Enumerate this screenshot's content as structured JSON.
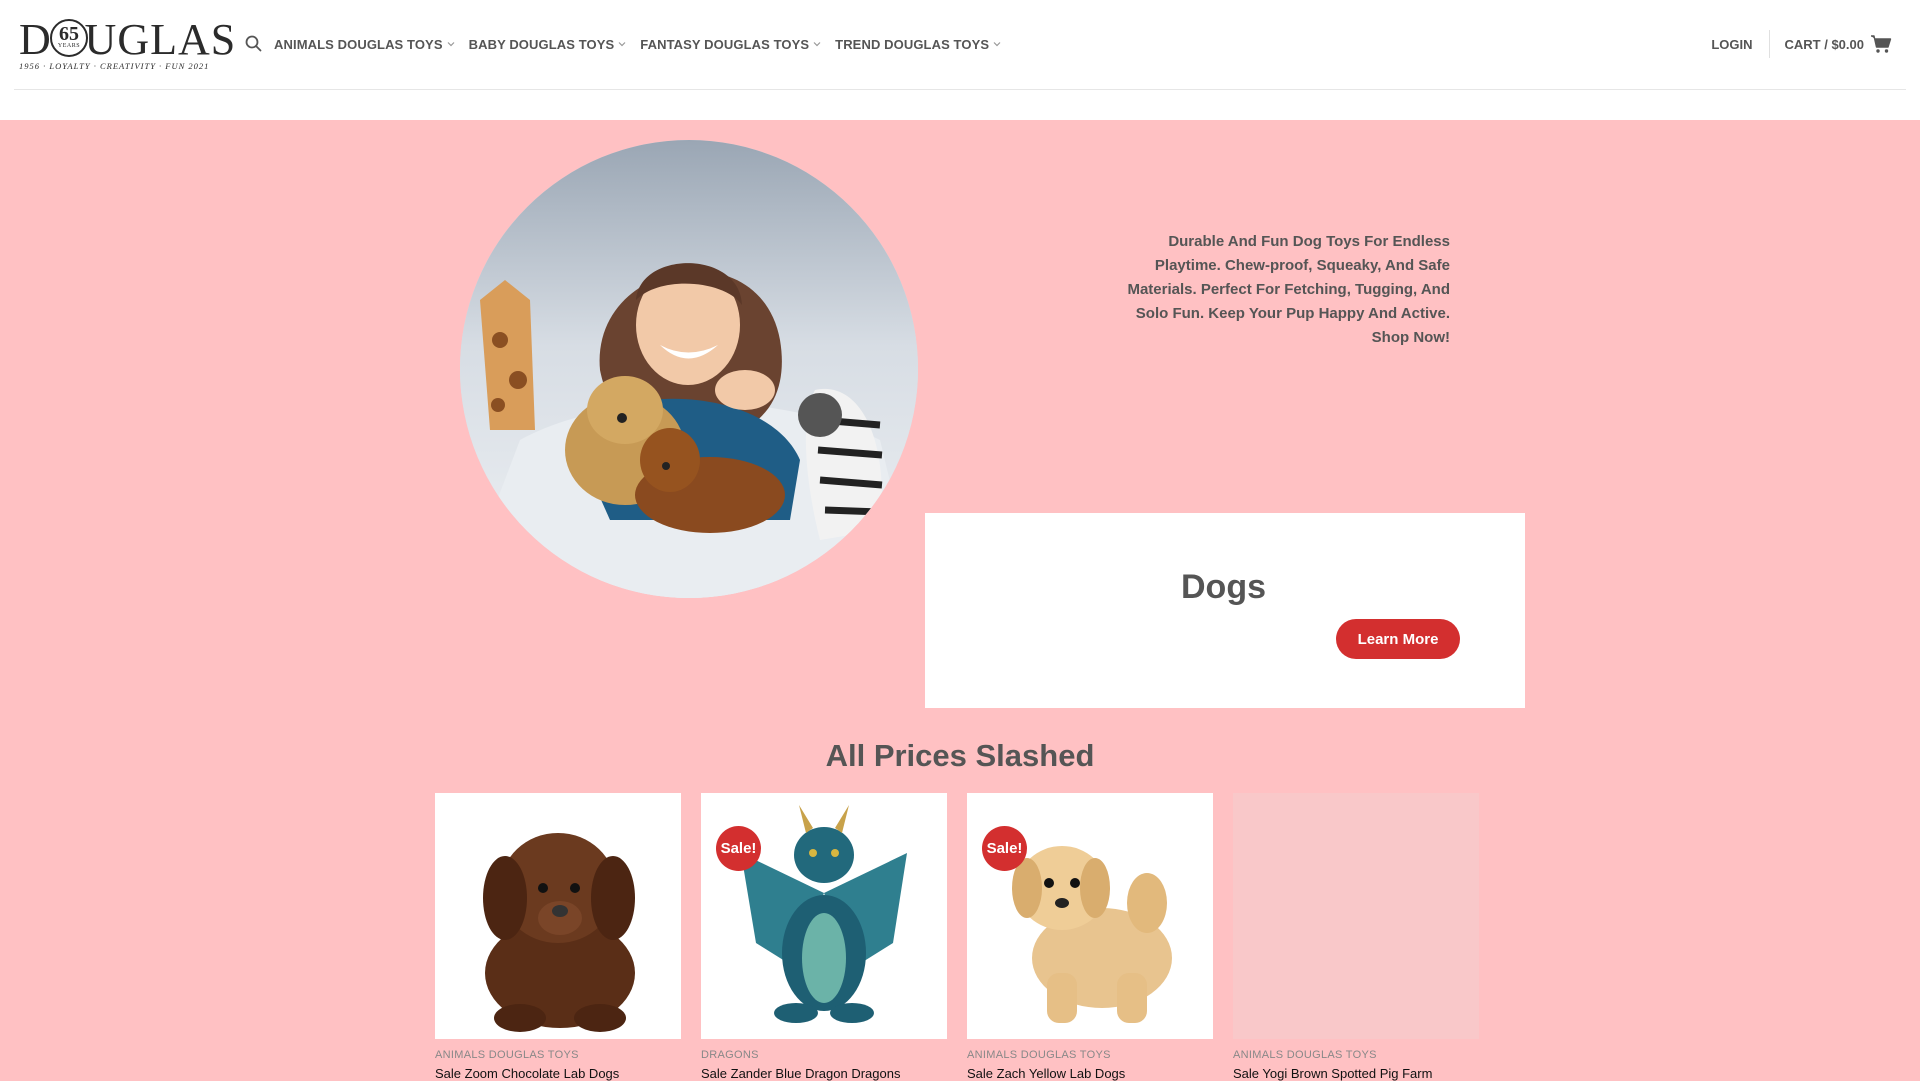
{
  "header": {
    "logo": {
      "word": "DOUGLAS",
      "years": "65",
      "years_label": "YEARS",
      "tagline": "1956 · LOYALTY · CREATIVITY · FUN 2021"
    },
    "search_icon": "search-icon",
    "nav": [
      {
        "label": "ANIMALS DOUGLAS TOYS"
      },
      {
        "label": "BABY DOUGLAS TOYS"
      },
      {
        "label": "FANTASY DOUGLAS TOYS"
      },
      {
        "label": "TREND DOUGLAS TOYS"
      }
    ],
    "login": "LOGIN",
    "cart": "CART / $0.00"
  },
  "hero": {
    "description": "Durable And Fun Dog Toys For Endless Playtime. Chew-proof, Squeaky, And Safe Materials. Perfect For Fetching, Tugging, And Solo Fun. Keep Your Pup Happy And Active. Shop Now!",
    "promo_title": "Dogs",
    "button": "Learn More"
  },
  "section_title": "All Prices Slashed",
  "products": [
    {
      "category": "ANIMALS DOUGLAS TOYS",
      "name": "Sale Zoom Chocolate Lab Dogs",
      "sale": "",
      "image": "brown-puppy"
    },
    {
      "category": "DRAGONS",
      "name": "Sale Zander Blue Dragon Dragons",
      "sale": "Sale!",
      "image": "blue-dragon"
    },
    {
      "category": "ANIMALS DOUGLAS TOYS",
      "name": "Sale Zach Yellow Lab Dogs",
      "sale": "Sale!",
      "image": "yellow-puppy"
    },
    {
      "category": "ANIMALS DOUGLAS TOYS",
      "name": "Sale Yogi Brown Spotted Pig Farm",
      "sale": "",
      "image": ""
    }
  ],
  "colors": {
    "background": "#ffc1c3",
    "accent": "#d32f2f",
    "text": "#555555"
  }
}
